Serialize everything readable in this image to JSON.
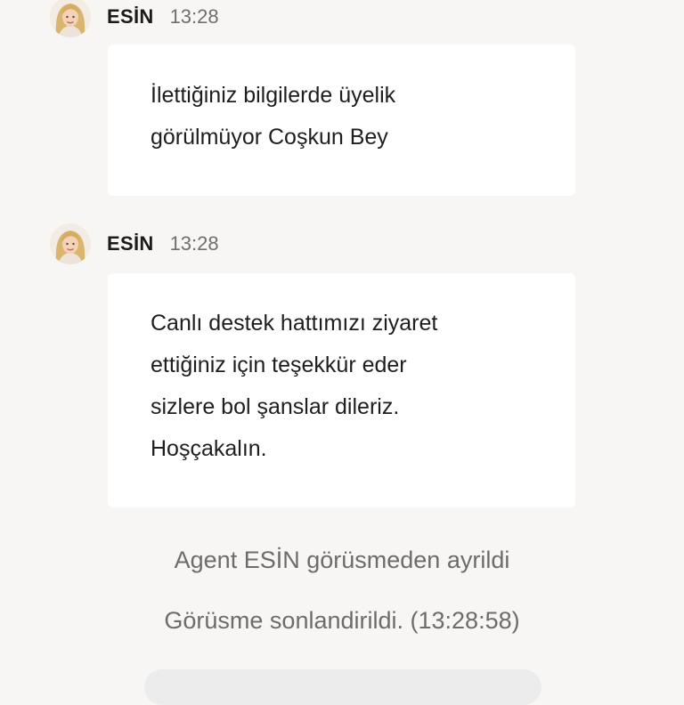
{
  "messages": [
    {
      "sender": "ESİN",
      "time": "13:28",
      "lines": [
        "İlettiğiniz bilgilerde üyelik",
        "görülmüyor Coşkun Bey"
      ]
    },
    {
      "sender": "ESİN",
      "time": "13:28",
      "lines": [
        "Canlı destek hattımızı ziyaret",
        "ettiğiniz için teşekkür eder",
        "sizlere bol şanslar dileriz.",
        "Hoşçakalın."
      ]
    }
  ],
  "system": {
    "agent_left": "Agent ESİN görüsmeden ayrildi",
    "ended": "Görüsme sonlandirildi. (13:28:58)"
  },
  "icons": {
    "avatar": "agent-avatar-icon"
  },
  "colors": {
    "background": "#f8f6f4",
    "bubble": "#ffffff",
    "sender_text": "#1b1b1b",
    "time_text": "#6f6f6f",
    "system_text": "#6c6c6c"
  }
}
